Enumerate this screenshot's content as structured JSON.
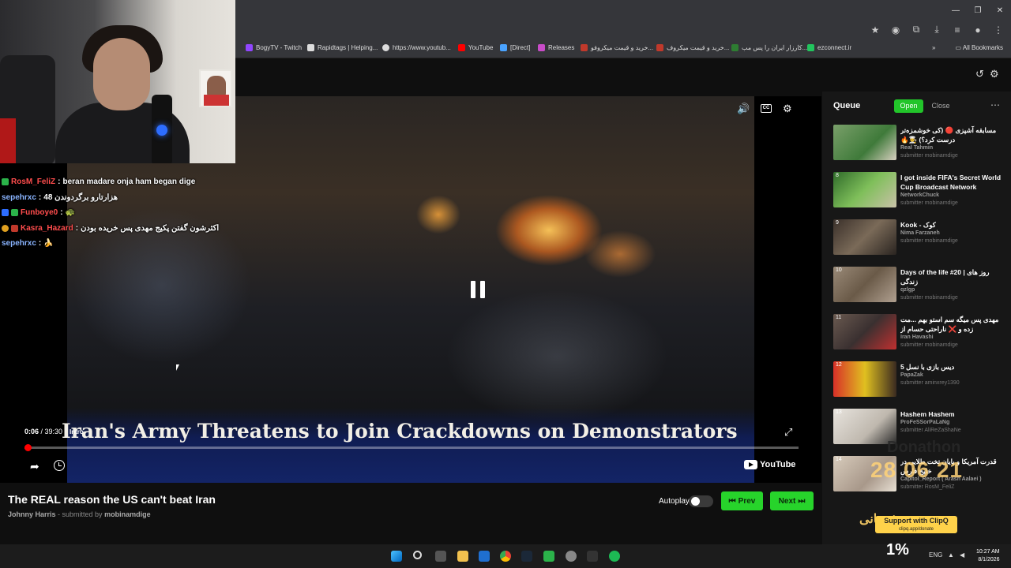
{
  "browser": {
    "bookmarks": [
      {
        "label": "BogyTV - Twitch",
        "color": "#9146ff"
      },
      {
        "label": "Rapidtags | Helping...",
        "color": "#dddddd"
      },
      {
        "label": "https://www.youtub...",
        "color": "#dddddd"
      },
      {
        "label": "YouTube",
        "color": "#ff0000"
      },
      {
        "label": "[Direct]",
        "color": "#4aa3ff"
      },
      {
        "label": "Releases",
        "color": "#c94cc9"
      },
      {
        "label": "خرید و قیمت میکروفو...",
        "color": "#c0392b"
      },
      {
        "label": "خرید و قیمت میکروف...",
        "color": "#c0392b"
      },
      {
        "label": "کارزار ایران را پس مب...",
        "color": "#2e7d32"
      },
      {
        "label": "ezconnect.ir",
        "color": "#22c55e"
      }
    ],
    "all_bookmarks": "All Bookmarks"
  },
  "video": {
    "caption": "Iran's Army Threatens to Join Crackdowns on Demonstrators",
    "time_current": "0:06",
    "time_total": "39:30",
    "chapter": "Intro",
    "progress": 0.0025,
    "youtube_label": "YouTube",
    "title": "The REAL reason the US can't beat Iran",
    "channel": "Johnny Harris",
    "submitted_by_label": "submitted by",
    "submitter": "mobinamdige"
  },
  "chat": [
    {
      "user": "RosM_FeliZ",
      "user_color": "#ff4d4d",
      "message": "beran madare onja ham began dige"
    },
    {
      "user": "sepehrxc",
      "user_color": "#8ab4ff",
      "message": "48 هزارتارو برگردوندن"
    },
    {
      "user": "Funboye0",
      "user_color": "#ff4d4d",
      "message": "🐢"
    },
    {
      "user": "Kasra_Hazard",
      "user_color": "#ff4d4d",
      "message": "اکثرشون گفتن پکیج مهدی پس خریده بودن"
    },
    {
      "user": "sepehrxc",
      "user_color": "#8ab4ff",
      "message": "🍌"
    }
  ],
  "controls": {
    "autoplay_label": "Autoplay",
    "prev_label": "Prev",
    "next_label": "Next"
  },
  "queue": {
    "title": "Queue",
    "open_label": "Open",
    "close_label": "Close",
    "items": [
      {
        "num": "",
        "title": "مسابقه آشپزی 🔴 (کی خوشمزه‌تر درست کرد؟) 👨‍🍳🔥",
        "channel": "Real Tahmin",
        "submitter": "submitter mobinamdige",
        "thumb": "#3f7a3a"
      },
      {
        "num": "8",
        "title": "I got inside FIFA's Secret World Cup Broadcast Network",
        "channel": "NetworkChuck",
        "submitter": "submitter mobinamdige",
        "thumb": "#4c8a3c"
      },
      {
        "num": "9",
        "title": "Kook - کوک",
        "channel": "Nima Farzaneh",
        "submitter": "submitter mobinamdige",
        "thumb": "#5a4a3a"
      },
      {
        "num": "10",
        "title": "Days of the life #20 | روز های زندگی",
        "channel": "qzlgp",
        "submitter": "submitter mobinamdige",
        "thumb": "#8a7a6a"
      },
      {
        "num": "11",
        "title": "مهدی پس میگه سم استو بهم ...مت زده و ❌ ناراحتی حسام از",
        "channel": "Iran Havashi",
        "submitter": "submitter mobinamdige",
        "thumb": "#6a5a50"
      },
      {
        "num": "12",
        "title": "دیس بازی با نسل 5",
        "channel": "PapaZak",
        "submitter": "submitter aminxrey1390",
        "thumb": "#c0302a"
      },
      {
        "num": "13",
        "title": "Hashem Hashem",
        "channel": "ProFeSSorPaLaNg",
        "submitter": "submitter AliReZaShaNe",
        "thumb": "#d8d4cf"
      },
      {
        "num": "14",
        "title": "قدرت آمریکا و پایان تخت طلایی در خلیج فارس",
        "channel": "Capitol_Report ( Arash Aalaei )",
        "submitter": "submitter RosM_FeliZ",
        "thumb": "#c4b6a8"
      }
    ]
  },
  "overlay": {
    "donathon": "Donathon",
    "timer": "28 06 21",
    "clipq_label": "Support with ClipQ",
    "clipq_url": "clipq.app/donate",
    "gift_text": "پیشتیبانی"
  },
  "taskbar": {
    "lang": "ENG",
    "percent": "1%",
    "time": "10:27 AM",
    "date": "8/1/2026"
  }
}
